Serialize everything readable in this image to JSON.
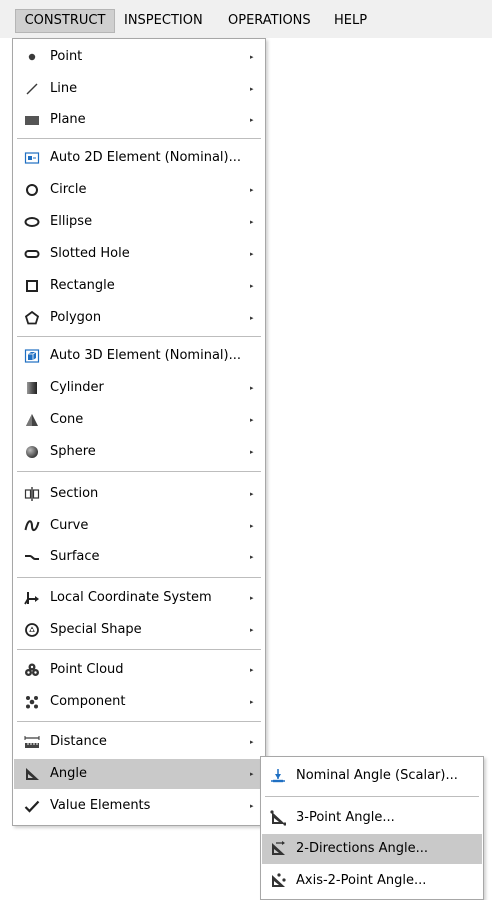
{
  "menubar": {
    "items": [
      {
        "label": "CONSTRUCT",
        "active": true
      },
      {
        "label": "INSPECTION",
        "active": false
      },
      {
        "label": "OPERATIONS",
        "active": false
      },
      {
        "label": "HELP",
        "active": false
      }
    ]
  },
  "construct_menu": {
    "items": [
      {
        "label": "Point",
        "icon": "point-icon",
        "has_submenu": true
      },
      {
        "label": "Line",
        "icon": "line-icon",
        "has_submenu": true
      },
      {
        "label": "Plane",
        "icon": "plane-icon",
        "has_submenu": true
      },
      {
        "label": "Auto 2D Element (Nominal)...",
        "icon": "auto-2d-element-icon",
        "has_submenu": false
      },
      {
        "label": "Circle",
        "icon": "circle-icon",
        "has_submenu": true
      },
      {
        "label": "Ellipse",
        "icon": "ellipse-icon",
        "has_submenu": true
      },
      {
        "label": "Slotted Hole",
        "icon": "slotted-hole-icon",
        "has_submenu": true
      },
      {
        "label": "Rectangle",
        "icon": "rectangle-icon",
        "has_submenu": true
      },
      {
        "label": "Polygon",
        "icon": "polygon-icon",
        "has_submenu": true
      },
      {
        "label": "Auto 3D Element (Nominal)...",
        "icon": "auto-3d-element-icon",
        "has_submenu": false
      },
      {
        "label": "Cylinder",
        "icon": "cylinder-icon",
        "has_submenu": true
      },
      {
        "label": "Cone",
        "icon": "cone-icon",
        "has_submenu": true
      },
      {
        "label": "Sphere",
        "icon": "sphere-icon",
        "has_submenu": true
      },
      {
        "label": "Section",
        "icon": "section-icon",
        "has_submenu": true
      },
      {
        "label": "Curve",
        "icon": "curve-icon",
        "has_submenu": true
      },
      {
        "label": "Surface",
        "icon": "surface-icon",
        "has_submenu": true
      },
      {
        "label": "Local Coordinate System",
        "icon": "coordinate-system-icon",
        "has_submenu": true
      },
      {
        "label": "Special Shape",
        "icon": "special-shape-icon",
        "has_submenu": true
      },
      {
        "label": "Point Cloud",
        "icon": "point-cloud-icon",
        "has_submenu": true
      },
      {
        "label": "Component",
        "icon": "component-icon",
        "has_submenu": true
      },
      {
        "label": "Distance",
        "icon": "distance-icon",
        "has_submenu": true
      },
      {
        "label": "Angle",
        "icon": "angle-icon",
        "has_submenu": true,
        "highlighted": true
      },
      {
        "label": "Value Elements",
        "icon": "checkmark-icon",
        "has_submenu": true
      }
    ],
    "submenu_arrow": "▸"
  },
  "angle_submenu": {
    "items": [
      {
        "label": "Nominal Angle (Scalar)...",
        "icon": "nominal-angle-icon"
      },
      {
        "label": "3-Point Angle...",
        "icon": "three-point-angle-icon"
      },
      {
        "label": "2-Directions Angle...",
        "icon": "two-directions-angle-icon",
        "highlighted": true
      },
      {
        "label": "Axis-2-Point Angle...",
        "icon": "axis-two-point-angle-icon"
      }
    ]
  },
  "colors": {
    "menubar_bg": "#f0f0f0",
    "highlight": "#c9c9c9",
    "accent_blue": "#1f6fc2",
    "icon_dark": "#3a3a3a"
  }
}
